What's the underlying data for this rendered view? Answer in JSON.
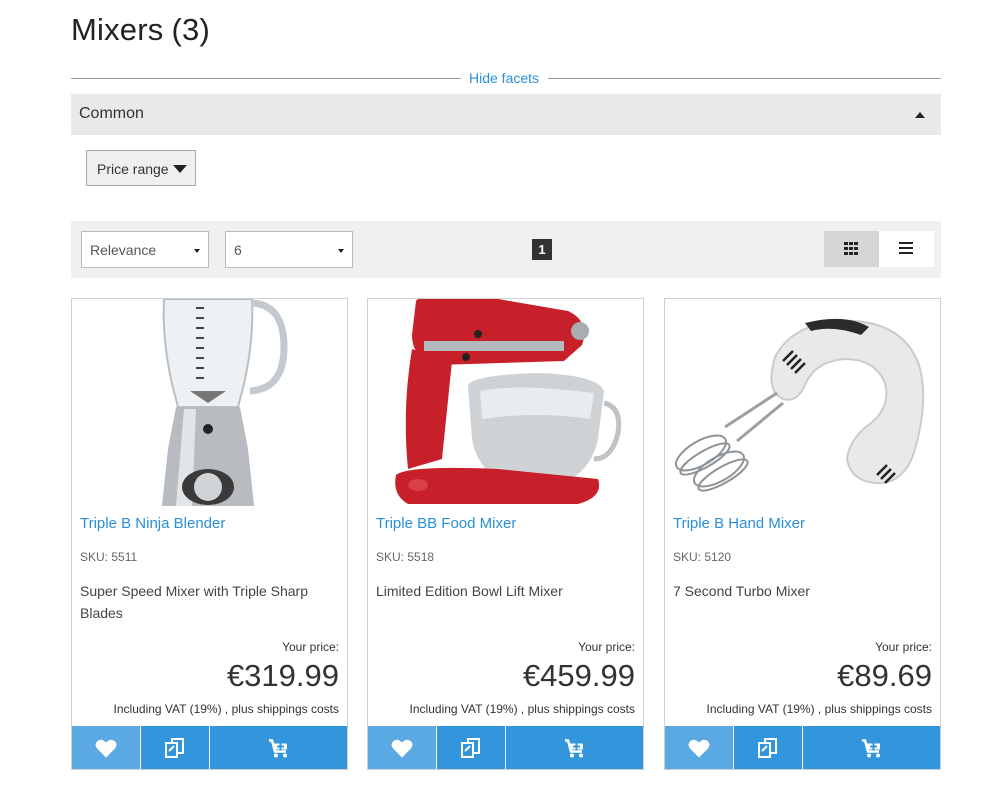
{
  "header": {
    "title": "Mixers",
    "count": "(3)"
  },
  "facets": {
    "toggle_label": "Hide facets",
    "group_label": "Common",
    "price_range_label": "Price range"
  },
  "toolbar": {
    "sort_value": "Relevance",
    "page_size_value": "6",
    "current_page": "1"
  },
  "products": [
    {
      "name": "Triple B Ninja Blender",
      "sku": "SKU: 5511",
      "description": "Super Speed Mixer with Triple Sharp Blades",
      "your_price_label": "Your price:",
      "price": "€319.99",
      "vat_note": "Including VAT (19%) , plus shippings costs"
    },
    {
      "name": "Triple BB Food Mixer",
      "sku": "SKU: 5518",
      "description": "Limited Edition Bowl Lift Mixer",
      "your_price_label": "Your price:",
      "price": "€459.99",
      "vat_note": "Including VAT (19%) , plus shippings costs"
    },
    {
      "name": "Triple B Hand Mixer",
      "sku": "SKU: 5120",
      "description": "7 Second Turbo Mixer",
      "your_price_label": "Your price:",
      "price": "€89.69",
      "vat_note": "Including VAT (19%) , plus shippings costs"
    }
  ],
  "icons": {
    "wishlist": "heart-icon",
    "compare": "compare-icon",
    "cart": "cart-icon",
    "grid_view": "grid-icon",
    "list_view": "list-icon"
  },
  "colors": {
    "accent": "#3395dc",
    "link": "#2a8fd8",
    "facet_bar": "#e9e9e9"
  }
}
